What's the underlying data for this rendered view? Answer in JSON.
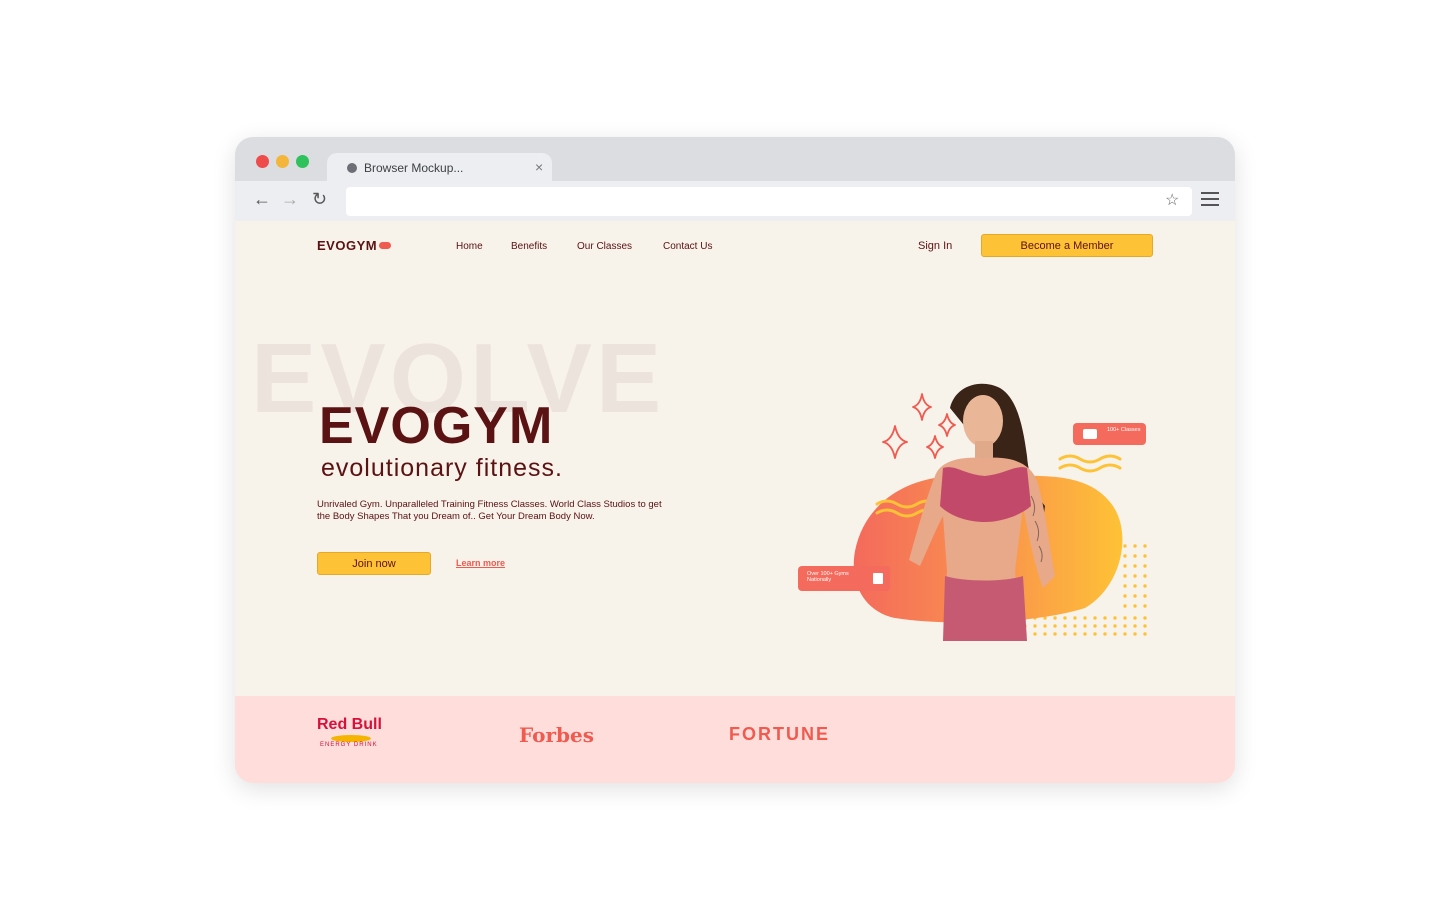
{
  "browser": {
    "tab_title": "Browser Mockup...",
    "tab_close": "×",
    "back": "←",
    "forward": "→",
    "reload": "↻",
    "bookmark_star": "☆",
    "url": ""
  },
  "site": {
    "logo": "EVOGYM",
    "nav": [
      "Home",
      "Benefits",
      "Our Classes",
      "Contact Us"
    ],
    "sign_in": "Sign In",
    "member_button": "Become a Member"
  },
  "hero": {
    "background_text": "EVOLVE",
    "title": "EVOGYM",
    "subtitle": "evolutionary fitness.",
    "description": "Unrivaled Gym. Unparalleled Training Fitness Classes. World Class Studios to get the Body Shapes That you Dream of.. Get Your Dream Body Now.",
    "join_button": "Join now",
    "learn_more": "Learn more",
    "badge_classes": "100+ Classes",
    "badge_gyms": "Over 100+ Gyms Nationally"
  },
  "sponsors": {
    "redbull": "Red Bull",
    "redbull_sub": "ENERGY DRINK",
    "forbes": "Forbes",
    "fortune": "FORTUNE"
  },
  "colors": {
    "brand": "#5b1212",
    "accent_yellow": "#fec236",
    "accent_red": "#f05a4f",
    "page_bg": "#f7f2ea",
    "sponsor_bg": "#fedddb"
  }
}
